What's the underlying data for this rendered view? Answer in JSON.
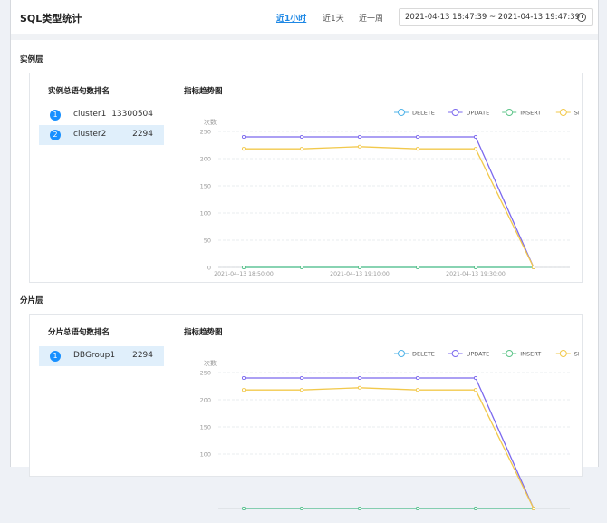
{
  "header": {
    "title": "SQL类型统计",
    "tabs": [
      {
        "label": "近1小时",
        "active": true
      },
      {
        "label": "近1天",
        "active": false
      },
      {
        "label": "近一周",
        "active": false
      }
    ],
    "date_range": "2021-04-13 18:47:39 ~ 2021-04-13 19:47:39",
    "date_icon": "clock-icon"
  },
  "instance_section": {
    "label": "实例层",
    "ranking_title": "实例总语句数排名",
    "ranking": [
      {
        "rank": "1",
        "name": "cluster1",
        "value": "13300504",
        "selected": false
      },
      {
        "rank": "2",
        "name": "cluster2",
        "value": "2294",
        "selected": true
      }
    ],
    "chart_title": "指标趋势图"
  },
  "shard_section": {
    "label": "分片层",
    "ranking_title": "分片总语句数排名",
    "ranking": [
      {
        "rank": "1",
        "name": "DBGroup1",
        "value": "2294",
        "selected": true
      }
    ],
    "chart_title": "指标趋势图"
  },
  "chart_data": [
    {
      "type": "line",
      "ylabel": "次数",
      "ylim": [
        0,
        250
      ],
      "yticks": [
        0,
        50,
        100,
        150,
        200,
        250
      ],
      "x_tick_labels": [
        "2021-04-13 18:50:00",
        "2021-04-13 19:10:00",
        "2021-04-13 19:30:00"
      ],
      "legend": "top-right",
      "grid": true,
      "series": [
        {
          "name": "DELETE",
          "color": "#4fb3e8",
          "values": [
            0,
            0,
            0,
            0,
            0,
            0
          ]
        },
        {
          "name": "UPDATE",
          "color": "#7b68ee",
          "values": [
            240,
            240,
            240,
            240,
            240,
            0
          ]
        },
        {
          "name": "INSERT",
          "color": "#5cc488",
          "values": [
            0,
            0,
            0,
            0,
            0,
            0
          ]
        },
        {
          "name": "SELECT",
          "color": "#f2c94c",
          "values": [
            218,
            218,
            222,
            218,
            218,
            0
          ]
        }
      ]
    },
    {
      "type": "line",
      "ylabel": "次数",
      "ylim": [
        0,
        250
      ],
      "yticks": [
        100,
        150,
        200,
        250
      ],
      "legend": "top-right",
      "grid": true,
      "series": [
        {
          "name": "DELETE",
          "color": "#4fb3e8",
          "values": [
            0,
            0,
            0,
            0,
            0,
            0
          ]
        },
        {
          "name": "UPDATE",
          "color": "#7b68ee",
          "values": [
            240,
            240,
            240,
            240,
            240,
            0
          ]
        },
        {
          "name": "INSERT",
          "color": "#5cc488",
          "values": [
            0,
            0,
            0,
            0,
            0,
            0
          ]
        },
        {
          "name": "SELECT",
          "color": "#f2c94c",
          "values": [
            218,
            218,
            222,
            218,
            218,
            0
          ]
        }
      ]
    }
  ]
}
